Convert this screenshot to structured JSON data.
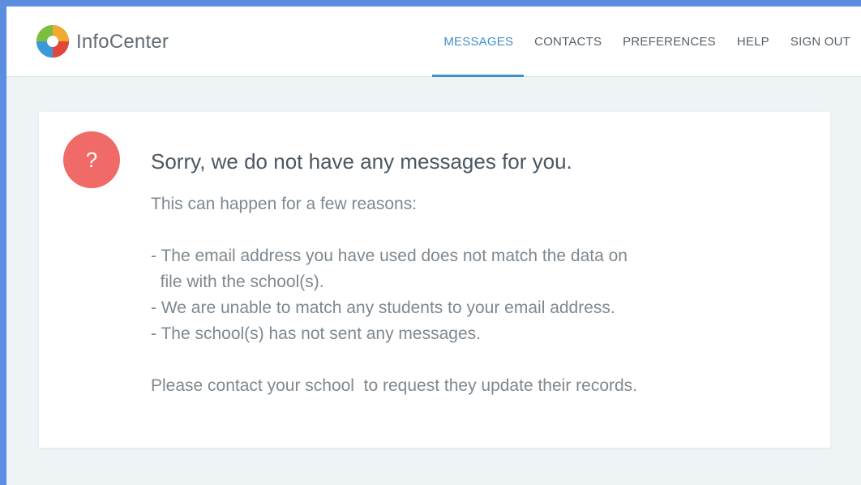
{
  "header": {
    "brand": "InfoCenter",
    "nav": [
      {
        "label": "MESSAGES",
        "active": true
      },
      {
        "label": "CONTACTS",
        "active": false
      },
      {
        "label": "PREFERENCES",
        "active": false
      },
      {
        "label": "HELP",
        "active": false
      },
      {
        "label": "SIGN OUT",
        "active": false
      }
    ]
  },
  "message": {
    "icon_glyph": "?",
    "title": "Sorry, we do not have any messages for you.",
    "intro": "This can happen for a few reasons:",
    "reasons": [
      "- The email address you have used does not match the data on",
      "  file with the school(s).",
      "- We are unable to match any students to your email address.",
      "- The school(s) has not sent any messages."
    ],
    "closing": "Please contact your school  to request they update their records."
  },
  "colors": {
    "accent": "#3f8fcf",
    "alert": "#f06b67",
    "frame_border": "#5b8ee0"
  }
}
